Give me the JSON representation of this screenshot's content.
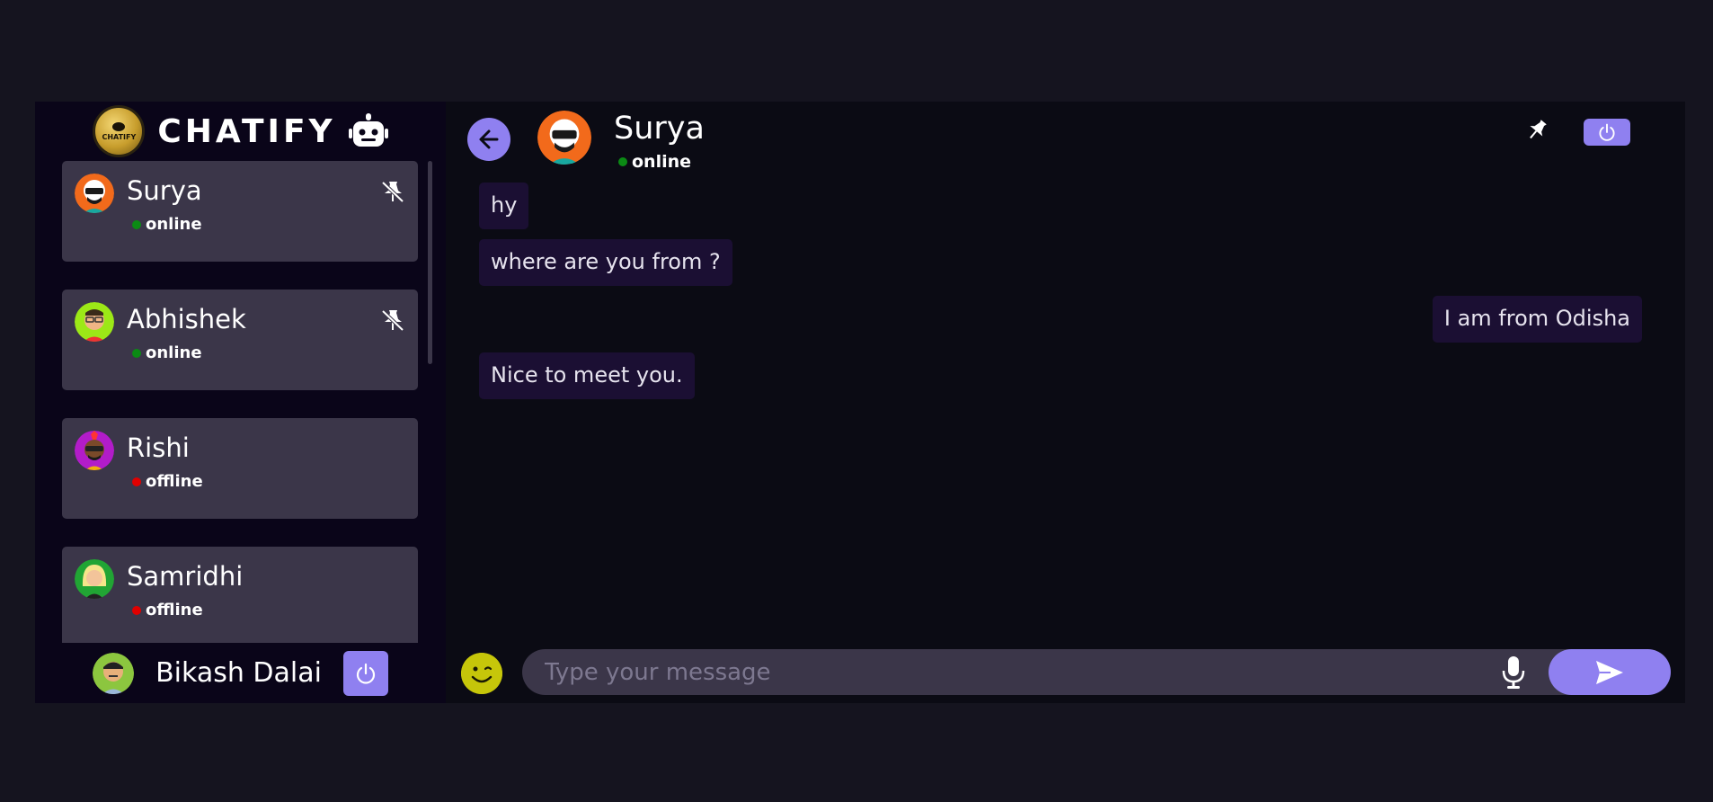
{
  "brand": {
    "name": "CHATIFY",
    "logo_text": "CHATIFY"
  },
  "contacts": [
    {
      "name": "Surya",
      "status": "online",
      "pinned": true
    },
    {
      "name": "Abhishek",
      "status": "online",
      "pinned": true
    },
    {
      "name": "Rishi",
      "status": "offline",
      "pinned": false
    },
    {
      "name": "Samridhi",
      "status": "offline",
      "pinned": false
    }
  ],
  "current_user": {
    "name": "Bikash Dalai"
  },
  "chat": {
    "contact_name": "Surya",
    "contact_status": "online",
    "messages": [
      {
        "text": "hy",
        "direction": "incoming"
      },
      {
        "text": "where are you from ?",
        "direction": "incoming"
      },
      {
        "text": "I am from Odisha",
        "direction": "outgoing"
      },
      {
        "text": "Nice to meet you.",
        "direction": "incoming"
      }
    ]
  },
  "composer": {
    "placeholder": "Type your message"
  },
  "colors": {
    "accent": "#8f80f0",
    "online": "#0b8a14",
    "offline": "#e00000",
    "card": "#3b3649",
    "bubble": "#1b0f33"
  },
  "icons": [
    "chatbot-icon",
    "unpin-icon",
    "power-icon",
    "back-arrow-icon",
    "pin-icon",
    "emoji-icon",
    "microphone-icon",
    "send-icon"
  ]
}
